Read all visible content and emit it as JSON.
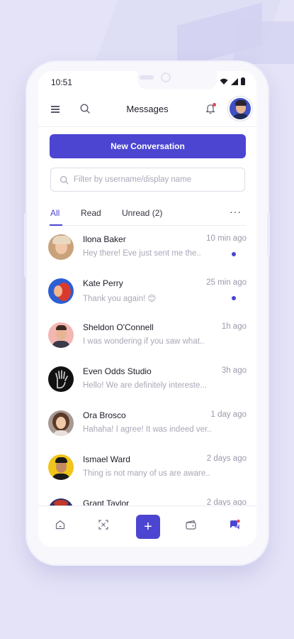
{
  "status_bar": {
    "time": "10:51"
  },
  "header": {
    "title": "Messages"
  },
  "new_conversation_label": "New Conversation",
  "filter": {
    "placeholder": "Filter by username/display name",
    "value": ""
  },
  "tabs": [
    {
      "label": "All",
      "active": true
    },
    {
      "label": "Read",
      "active": false
    },
    {
      "label": "Unread (2)",
      "active": false
    }
  ],
  "tabs_more_label": "···",
  "conversations": [
    {
      "name": "Ilona Baker",
      "preview": "Hey there! Eve just sent me the..",
      "time": "10 min ago",
      "unread": true
    },
    {
      "name": "Kate Perry",
      "preview": "Thank you again! 😊",
      "time": "25 min ago",
      "unread": true
    },
    {
      "name": "Sheldon O'Connell",
      "preview": "I was wondering if you saw what..",
      "time": "1h ago",
      "unread": false
    },
    {
      "name": "Even Odds Studio",
      "preview": "Hello! We are definitely intereste...",
      "time": "3h ago",
      "unread": false
    },
    {
      "name": "Ora Brosco",
      "preview": "Hahaha! I agree! It was indeed ver..",
      "time": "1 day ago",
      "unread": false
    },
    {
      "name": "Ismael Ward",
      "preview": "Thing is not many of us are aware..",
      "time": "2 days ago",
      "unread": false
    },
    {
      "name": "Grant Taylor",
      "preview": "",
      "time": "2 days ago",
      "unread": false
    }
  ],
  "bottom_nav": {
    "add_label": "+"
  },
  "colors": {
    "accent": "#4b45d1",
    "background": "#e4e3f7",
    "notification": "#e5484d"
  }
}
